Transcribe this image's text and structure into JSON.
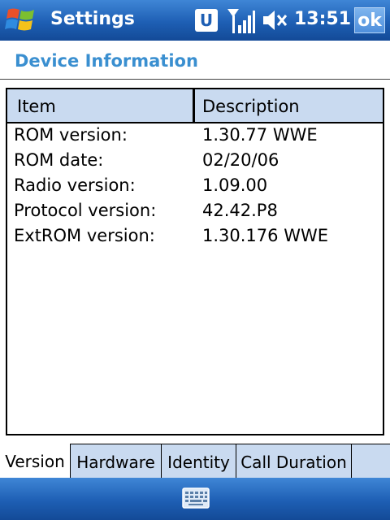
{
  "titlebar": {
    "app_title": "Settings",
    "u_badge": "U",
    "time": "13:51",
    "ok_label": "ok"
  },
  "page": {
    "title": "Device Information"
  },
  "listview": {
    "headers": [
      "Item",
      "Description"
    ],
    "rows": [
      [
        "ROM version:",
        "1.30.77 WWE"
      ],
      [
        "ROM date:",
        "02/20/06"
      ],
      [
        "Radio version:",
        "1.09.00"
      ],
      [
        "Protocol version:",
        "42.42.P8"
      ],
      [
        "ExtROM version:",
        "1.30.176 WWE"
      ]
    ]
  },
  "tabs": [
    {
      "label": "Version",
      "active": true
    },
    {
      "label": "Hardware",
      "active": false
    },
    {
      "label": "Identity",
      "active": false
    },
    {
      "label": "Call Duration",
      "active": false
    }
  ],
  "icons": {
    "start": "windows-flag-icon",
    "signal": "signal-strength-icon",
    "volume": "speaker-muted-icon",
    "keyboard": "keyboard-icon"
  },
  "colors": {
    "titlebar": "#1e5fb4",
    "heading": "#3a8fd0",
    "header_bg": "#c9daf0"
  }
}
